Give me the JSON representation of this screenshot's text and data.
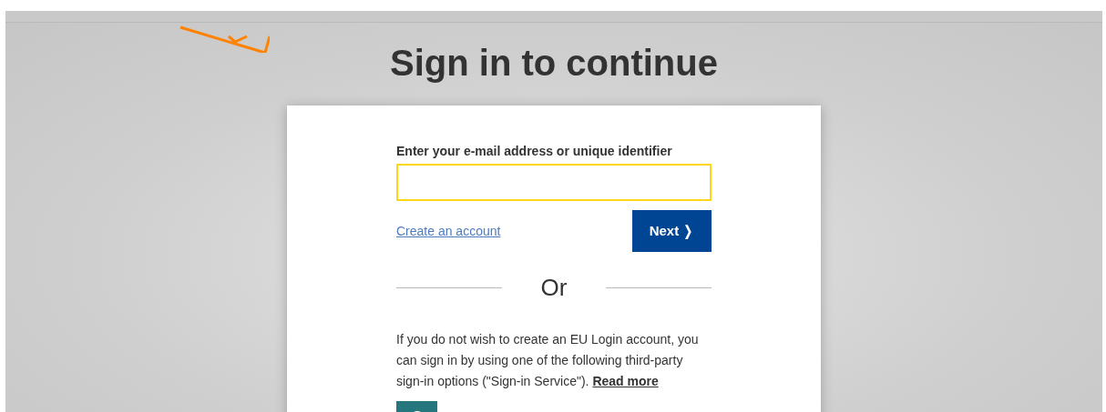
{
  "title": "Sign in to continue",
  "login": {
    "label": "Enter your e-mail address or unique identifier",
    "create_account": "Create an account",
    "next_button": "Next",
    "next_glyph": "❭"
  },
  "divider": "Or",
  "third_party": {
    "text": "If you do not wish to create an EU Login account, you can sign in by using one of the following third-party sign-in options (\"Sign-in Service\").",
    "link": "Read more"
  }
}
